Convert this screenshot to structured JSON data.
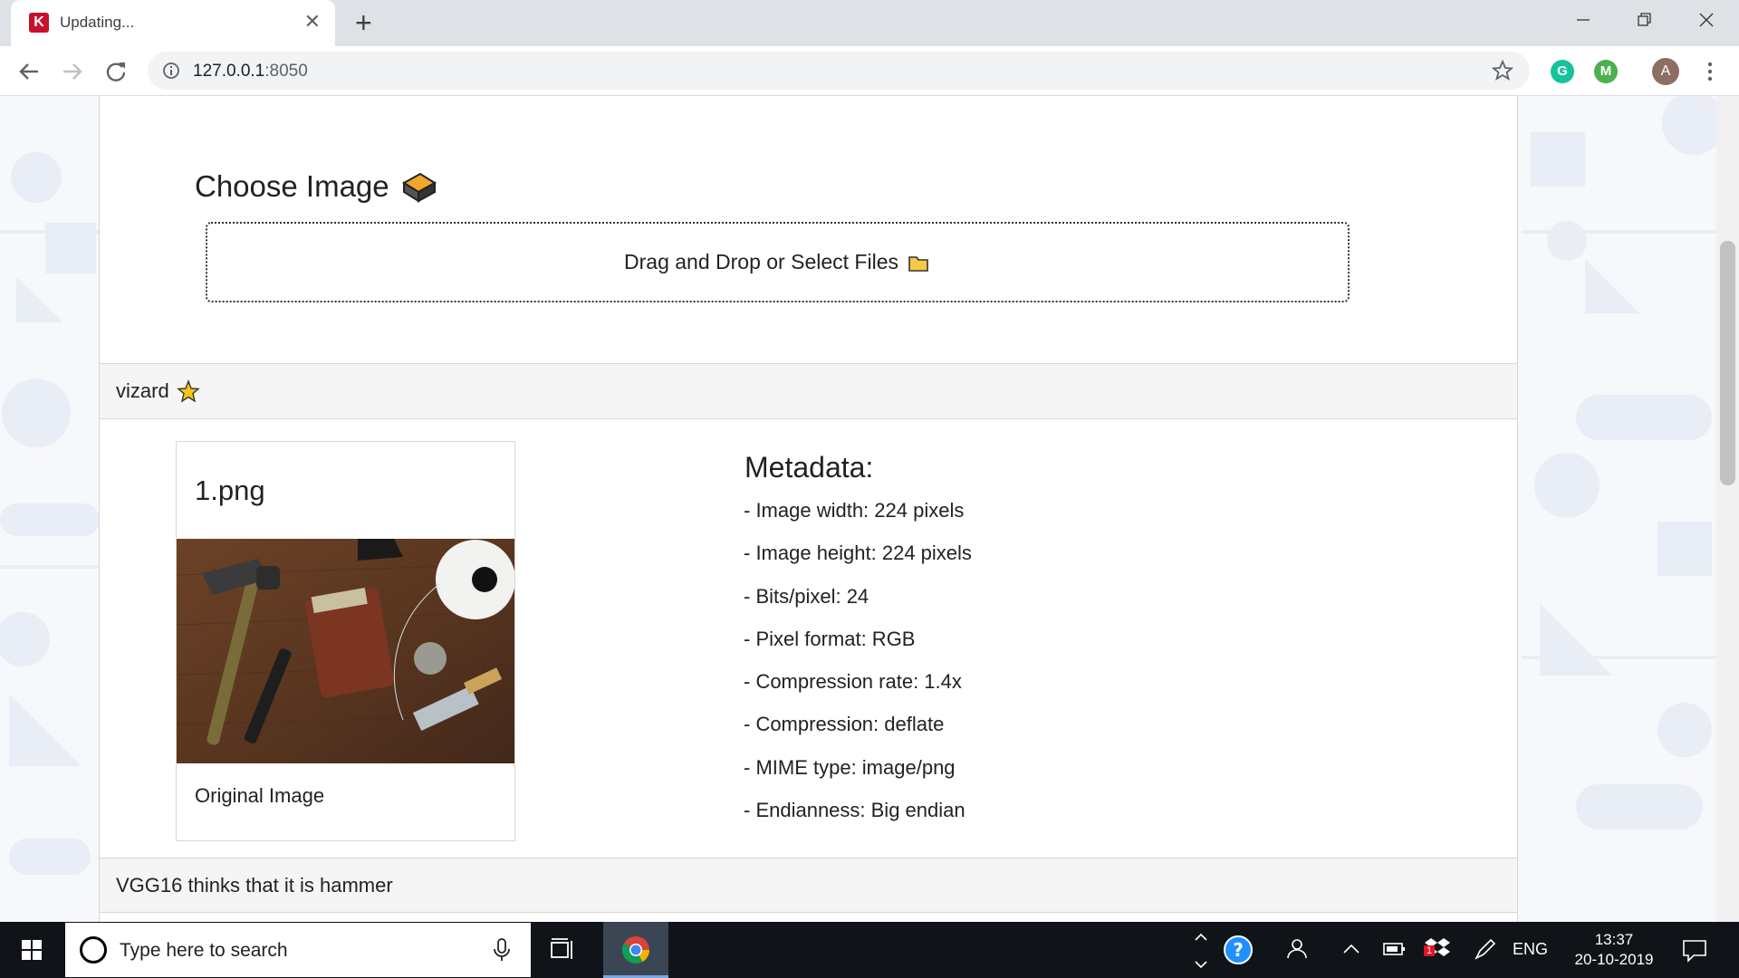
{
  "browser": {
    "tab_title": "Updating...",
    "favicon_letter": "K",
    "url_host": "127.0.0.1",
    "url_port": ":8050",
    "profile_initial": "A",
    "extensions": [
      "G",
      "M"
    ]
  },
  "upload": {
    "heading": "Choose Image",
    "dropzone_label": "Drag and Drop or Select Files"
  },
  "result": {
    "header": "vizard",
    "file_name": "1.png",
    "caption": "Original Image",
    "metadata_title": "Metadata:",
    "metadata": [
      "- Image width: 224 pixels",
      "- Image height: 224 pixels",
      "- Bits/pixel: 24",
      "- Pixel format: RGB",
      "- Compression rate: 1.4x",
      "- Compression: deflate",
      "- MIME type: image/png",
      "- Endianness: Big endian"
    ]
  },
  "prediction": {
    "header": "VGG16 thinks that it is hammer"
  },
  "taskbar": {
    "search_placeholder": "Type here to search",
    "language": "ENG",
    "time": "13:37",
    "date": "20-10-2019",
    "badge_count": "1"
  },
  "colors": {
    "accent_star": "#f5c518",
    "tab_bg": "#dee1e6",
    "taskbar_bg": "#101419"
  }
}
